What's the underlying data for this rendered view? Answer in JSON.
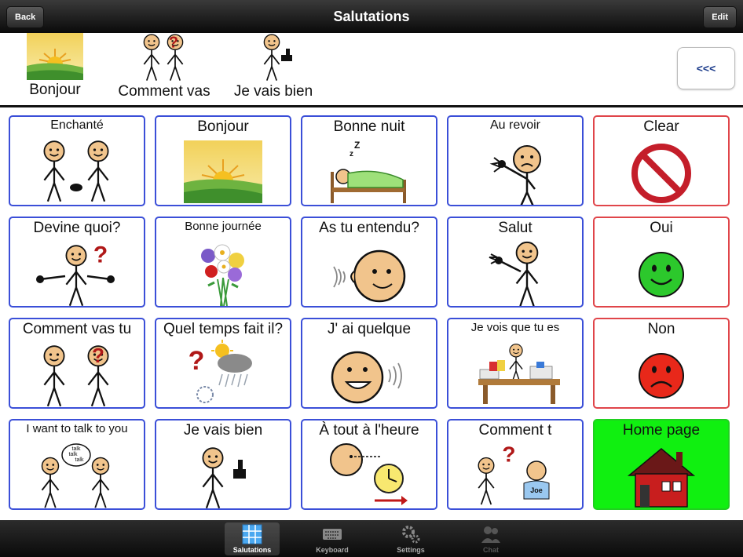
{
  "navbar": {
    "title": "Salutations",
    "back_label": "Back",
    "edit_label": "Edit"
  },
  "sentence": {
    "items": [
      {
        "label": "Bonjour",
        "icon": "sunrise-icon"
      },
      {
        "label": "Comment vas",
        "icon": "two-people-question-icon"
      },
      {
        "label": "Je vais bien",
        "icon": "person-thumbs-up-icon"
      }
    ],
    "backspace_label": "<<<"
  },
  "grid": {
    "cells": [
      {
        "label": "Enchanté",
        "icon": "handshake-icon",
        "border": "#3b4fd8"
      },
      {
        "label": "Bonjour",
        "icon": "sunrise-icon",
        "border": "#3b4fd8"
      },
      {
        "label": "Bonne nuit",
        "icon": "sleeping-bed-icon",
        "border": "#3b4fd8"
      },
      {
        "label": "Au revoir",
        "icon": "waving-sad-person-icon",
        "border": "#3b4fd8"
      },
      {
        "label": "Clear",
        "icon": "prohibited-icon",
        "border": "#e0454a"
      },
      {
        "label": "Devine quoi?",
        "icon": "person-question-icon",
        "border": "#3b4fd8"
      },
      {
        "label": "Bonne journée",
        "icon": "flower-bouquet-icon",
        "border": "#3b4fd8"
      },
      {
        "label": "As tu entendu?",
        "icon": "ear-face-icon",
        "border": "#3b4fd8"
      },
      {
        "label": "Salut",
        "icon": "waving-person-icon",
        "border": "#3b4fd8"
      },
      {
        "label": "Oui",
        "icon": "green-smiley-icon",
        "border": "#e0454a"
      },
      {
        "label": "Comment vas tu",
        "icon": "two-people-question-icon",
        "border": "#3b4fd8"
      },
      {
        "label": "Quel temps fait il?",
        "icon": "weather-question-icon",
        "border": "#3b4fd8"
      },
      {
        "label": "J' ai quelque",
        "icon": "talking-face-icon",
        "border": "#3b4fd8"
      },
      {
        "label": "Je vois que tu es",
        "icon": "busy-desk-icon",
        "border": "#3b4fd8"
      },
      {
        "label": "Non",
        "icon": "red-frown-icon",
        "border": "#e0454a"
      },
      {
        "label": "I want to talk to you",
        "icon": "talk-bubble-icon",
        "border": "#3b4fd8"
      },
      {
        "label": "Je vais bien",
        "icon": "person-thumbs-up-icon",
        "border": "#3b4fd8"
      },
      {
        "label": "À tout à l'heure",
        "icon": "clock-later-icon",
        "border": "#3b4fd8"
      },
      {
        "label": "Comment t",
        "icon": "question-joe-icon",
        "border": "#3b4fd8"
      },
      {
        "label": "Home page",
        "icon": "red-house-icon",
        "border": "#20d020"
      }
    ],
    "joe_label": "Joe",
    "talk_words": [
      "talk",
      "talk",
      "talk"
    ]
  },
  "tabbar": {
    "tabs": [
      {
        "label": "Salutations",
        "icon": "grid-icon",
        "state": "active"
      },
      {
        "label": "Keyboard",
        "icon": "keyboard-icon",
        "state": "normal"
      },
      {
        "label": "Settings",
        "icon": "gears-icon",
        "state": "normal"
      },
      {
        "label": "Chat",
        "icon": "people-icon",
        "state": "disabled"
      }
    ]
  },
  "colors": {
    "cell_border": "#3b4fd8",
    "control_border": "#e0454a",
    "home_bg": "#10f010",
    "navbar": "#1a1a1a"
  }
}
